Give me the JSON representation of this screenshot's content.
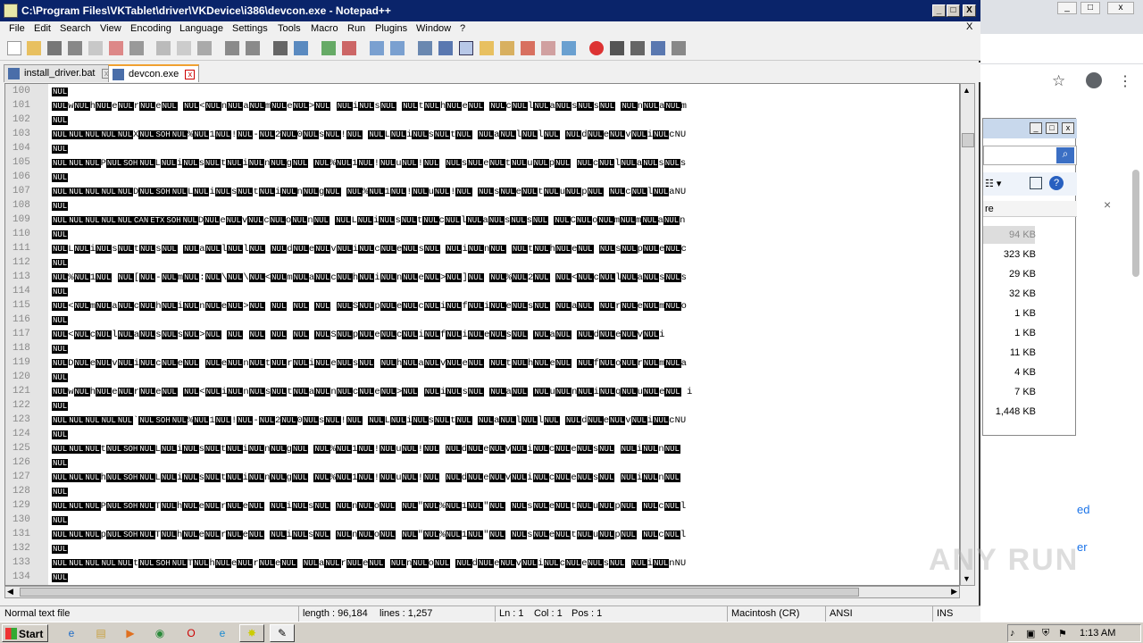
{
  "window": {
    "title": "C:\\Program Files\\VKTablet\\driver\\VKDevice\\i386\\devcon.exe - Notepad++",
    "min": "_",
    "max": "□",
    "close": "X"
  },
  "menu": {
    "items": [
      "File",
      "Edit",
      "Search",
      "View",
      "Encoding",
      "Language",
      "Settings",
      "Tools",
      "Macro",
      "Run",
      "Plugins",
      "Window",
      "?"
    ],
    "close_x": "X"
  },
  "tabs": [
    {
      "label": "install_driver.bat",
      "active": false
    },
    {
      "label": "devcon.exe",
      "active": true
    }
  ],
  "tab_close": "x",
  "editor": {
    "lines": [
      {
        "num": "100",
        "text": "NUL"
      },
      {
        "num": "101",
        "text": "NULwNULhNULeNULrNULeNUL  NUL<NULnNULaNULmNULeNUL>NUL  NULiNULsNUL  NULtNULhNULeNUL  NULcNULlNULaNULsNULsNUL  NULnNULaNULm"
      },
      {
        "num": "102",
        "text": "NUL"
      },
      {
        "num": "103",
        "text": "NULNULNULNULNULXNULSOHNUL%NUL1NUL!NUL-NUL2NUL0NULsNUL!NUL  NULLNULiNULsNULtNUL  NULaNULlNULlNUL  NULdNULeNULvNULiNULcNU"
      },
      {
        "num": "104",
        "text": "NUL"
      },
      {
        "num": "105",
        "text": "NULNULNULPNULSOHNULLNULiNULsNULtNULiNULnNULgNUL  NUL%NUL1NUL!NULuNUL!NUL  NULsNULeNULtNULuNULpNUL  NULcNULlNULaNULsNULs"
      },
      {
        "num": "106",
        "text": "NUL"
      },
      {
        "num": "107",
        "text": "NULNULNULNULNULDNULSOHNULLNULiNULsNULtNULiNULnNULgNUL  NUL%NUL1NUL!NULuNUL!NUL  NULsNULeNULtNULuNULpNUL  NULcNULlNULaNU"
      },
      {
        "num": "108",
        "text": "NUL"
      },
      {
        "num": "109",
        "text": "NULNULNULNULNULCANETXSOHNULDNULeNULvNULcNULoNULnNUL  NULLNULiNULsNULtNULcNULlNULaNULsNULsNUL  NULCNULoNULmNULmNULaNULn"
      },
      {
        "num": "110",
        "text": "NUL"
      },
      {
        "num": "111",
        "text": "NULLNULiNULsNULtNULsNUL  NULaNULlNULlNUL  NULdNULeNULvNULiNULcNULeNULsNUL  NULiNULnNUL  NULtNULhNULeNUL  NULsNULpNULeNULc"
      },
      {
        "num": "112",
        "text": "NUL"
      },
      {
        "num": "113",
        "text": "NUL%NUL1NUL  NUL[NUL-NULmNUL:NUL\\NUL\\NUL<NULmNULaNULcNULhNULiNULnNULeNUL>NUL]NUL  NUL%NUL2NUL  NUL<NULcNULlNULaNULsNULs"
      },
      {
        "num": "114",
        "text": "NUL"
      },
      {
        "num": "115",
        "text": "NUL<NULmNULaNULcNULhNULiNULnNULeNUL>NUL  NUL  NUL  NUL  NULSNULpNULeNULcNULiNULfNULiNULeNULsNUL  NULaNUL  NULrNULeNULmNULo"
      },
      {
        "num": "116",
        "text": "NUL"
      },
      {
        "num": "117",
        "text": "NUL<NULcNULlNULaNULsNULsNUL>NUL  NUL  NUL  NUL  NUL  NULSNULpNULeNULcNULiNULfNULiNULeNULsNUL  NULaNUL  NULdNULeNULvNULi"
      },
      {
        "num": "118",
        "text": "NUL"
      },
      {
        "num": "119",
        "text": "NULDNULeNULvNULiNULcNULeNUL  NULeNULnNULtNULrNULiNULeNULsNUL  NULhNULaNULvNULeNUL  NULtNULhNULeNUL  NULfNULoNULrNULmNULa"
      },
      {
        "num": "120",
        "text": "NUL"
      },
      {
        "num": "121",
        "text": "NULwNULhNULeNULrNULeNUL  NUL<NULiNULnNULsNULtNULaNULnNULcNULeNUL>NUL  NULiNULsNUL  NULaNUL  NULuNULnNULiNULqNULuNULeNUL i"
      },
      {
        "num": "122",
        "text": "NUL"
      },
      {
        "num": "123",
        "text": "NULNULNULNULNUL`NULSOHNUL%NUL1NUL!NUL-NUL2NUL0NULsNUL!NUL  NULLNULiNULsNULtNUL  NULaNULlNULlNUL  NULdNULeNULvNULiNULcNU"
      },
      {
        "num": "124",
        "text": "NUL"
      },
      {
        "num": "125",
        "text": "NULNULNULtNULSOHNULLNULiNULsNULtNULiNULnNULgNUL  NUL%NUL1NUL!NULuNUL!NUL  NULdNULeNULvNULiNULcNULeNULsNUL  NULiNULnNUL"
      },
      {
        "num": "126",
        "text": "NUL"
      },
      {
        "num": "127",
        "text": "NULNULNULhNULSOHNULLNULiNULsNULtNULiNULnNULgNUL  NUL%NUL1NUL!NULuNUL!NUL  NULdNULeNULvNULiNULcNULeNULsNUL  NULiNULnNUL"
      },
      {
        "num": "128",
        "text": "NUL"
      },
      {
        "num": "129",
        "text": "NULNULNULPNULSOHNULTNULhNULeNULrNULeNUL  NULiNULsNUL  NULnNULoNUL  NUL\"NUL%NUL1NUL\"NUL  NULsNULeNULtNULuNULpNUL  NULcNULl"
      },
      {
        "num": "130",
        "text": "NUL"
      },
      {
        "num": "131",
        "text": "NULNULNULpNULSOHNULTNULhNULeNULrNULeNUL  NULiNULsNUL  NULnNULoNUL  NUL\"NUL%NUL1NUL\"NUL  NULsNULeNULtNULuNULpNUL  NULcNULl"
      },
      {
        "num": "132",
        "text": "NUL"
      },
      {
        "num": "133",
        "text": "NULNULNULNULNULtNULSOHNULTNULhNULeNULrNULeNUL  NULaNULrNULeNUL  NULnNULoNUL  NULdNULeNULvNULiNULcNULeNULsNUL  NULiNULnNU"
      },
      {
        "num": "134",
        "text": "NUL"
      }
    ]
  },
  "status": {
    "filetype": "Normal text file",
    "length": "length : 96,184",
    "lines": "lines : 1,257",
    "ln": "Ln : 1",
    "col": "Col : 1",
    "pos": "Pos : 1",
    "eol": "Macintosh (CR)",
    "encoding": "ANSI",
    "mode": "INS"
  },
  "explorer": {
    "col_header": "re",
    "sizes": [
      "94 KB",
      "323 KB",
      "29 KB",
      "32 KB",
      "1 KB",
      "1 KB",
      "11 KB",
      "4 KB",
      "7 KB",
      "1,448 KB"
    ]
  },
  "browser": {
    "link1": "ed",
    "link2": "er"
  },
  "taskbar": {
    "start": "Start",
    "clock": "1:13 AM"
  },
  "watermark": "ANY RUN"
}
